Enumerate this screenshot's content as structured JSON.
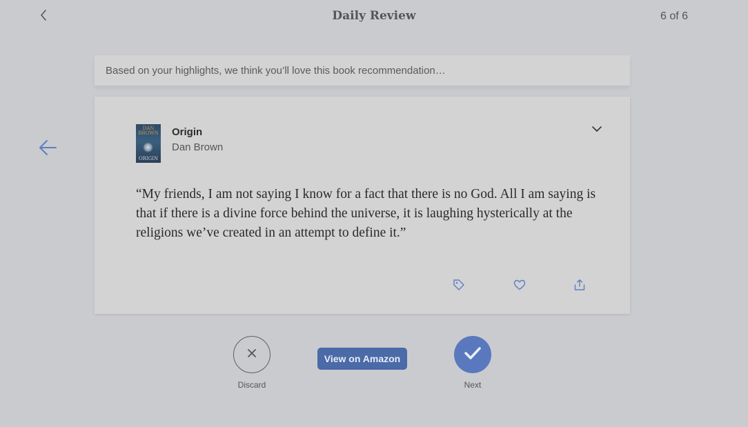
{
  "header": {
    "title": "Daily Review",
    "counter": "6 of 6",
    "back_icon": "chevron-left-icon"
  },
  "banner": {
    "text": "Based on your highlights, we think you’ll love this book recommendation…"
  },
  "nav": {
    "previous_icon": "arrow-left-icon"
  },
  "card": {
    "cover": {
      "author_text": "DAN BROWN",
      "title_text": "ORIGIN"
    },
    "book_title": "Origin",
    "book_author": "Dan Brown",
    "quote": "“My friends, I am not saying I know for a fact that there is no God. All I am saying is that if there is a divine force behind the universe, it is laughing hysterically at the religions we’ve created in an attempt to define it.”",
    "actions": [
      "tag-icon",
      "heart-icon",
      "share-icon"
    ],
    "expand_icon": "chevron-down-icon"
  },
  "footer": {
    "discard_label": "Discard",
    "amazon_label": "View on Amazon",
    "next_label": "Next"
  },
  "colors": {
    "background": "#cacbcf",
    "card": "#d3d3d4",
    "accent": "#4a6aa8",
    "next": "#5a78bd",
    "icon_blue": "#5b7fc0"
  }
}
